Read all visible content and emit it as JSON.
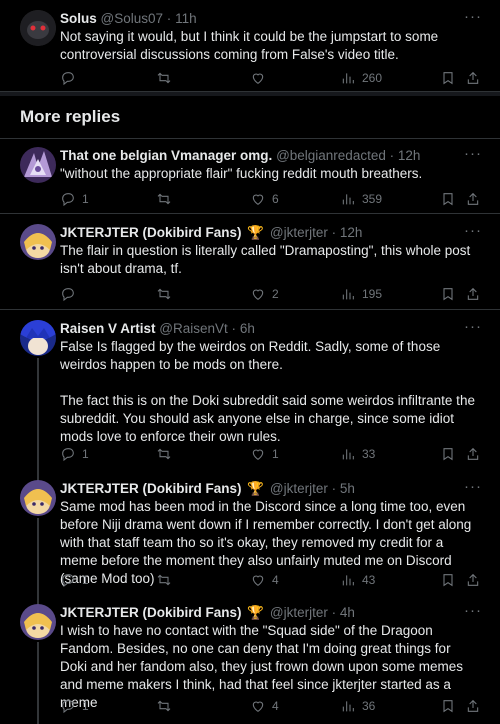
{
  "posts": [
    {
      "name": "Solus",
      "handle": "@Solus07",
      "time": "11h",
      "text": [
        "Not saying it would, but I think it could be the jumpstart to some controversial discussions coming from False's video title."
      ],
      "replies": "",
      "reposts": "",
      "likes": "",
      "views": "260"
    },
    {
      "name": "That one belgian Vmanager omg.",
      "handle": "@belgianredacted",
      "time": "12h",
      "text": [
        "\"without the appropriate flair\" fucking reddit mouth breathers."
      ],
      "replies": "1",
      "reposts": "",
      "likes": "6",
      "views": "359"
    },
    {
      "name": "JKTERJTER (Dokibird Fans)",
      "handle": "@jkterjter",
      "time": "12h",
      "text": [
        "The flair in question is literally called \"Dramaposting\", this whole post isn't about drama, tf."
      ],
      "replies": "",
      "reposts": "",
      "likes": "2",
      "views": "195"
    },
    {
      "name": "Raisen V Artist",
      "handle": "@RaisenVt",
      "time": "6h",
      "text": [
        "False Is flagged by the weirdos on Reddit. Sadly, some of those weirdos happen to be mods on there.",
        "The fact this is on the Doki subreddit said some weirdos infiltrante the subreddit. You should ask anyone else in charge, since some idiot mods love to enforce their own rules."
      ],
      "replies": "1",
      "reposts": "",
      "likes": "1",
      "views": "33"
    },
    {
      "name": "JKTERJTER (Dokibird Fans)",
      "handle": "@jkterjter",
      "time": "5h",
      "text": [
        "Same mod has been mod in the Discord since a long time too, even before Niji drama went down if I remember correctly. I don't get along with that staff team tho so it's okay, they removed my credit for a meme before the moment they also unfairly muted me on Discord (same Mod too)"
      ],
      "replies": "1",
      "reposts": "",
      "likes": "4",
      "views": "43"
    },
    {
      "name": "JKTERJTER (Dokibird Fans)",
      "handle": "@jkterjter",
      "time": "4h",
      "text": [
        "I wish to have no contact with the \"Squad side\" of the Dragoon Fandom. Besides, no one can deny that I'm doing great things for Doki and her fandom also, they just frown down upon some memes and meme makers I think, had that feel since jkterjter started as a meme"
      ],
      "replies": "1",
      "reposts": "",
      "likes": "4",
      "views": "36"
    }
  ],
  "section_title": "More replies",
  "dot": "·",
  "more_glyph": "···",
  "trophy": "🏆",
  "colors": {
    "background": "#000000",
    "text": "#e7e9ea",
    "muted": "#71767b",
    "border": "#2f3336",
    "trophy": "#f5b400"
  },
  "icons": [
    "reply-icon",
    "repost-icon",
    "like-icon",
    "views-icon",
    "bookmark-icon",
    "share-icon",
    "more-icon"
  ]
}
